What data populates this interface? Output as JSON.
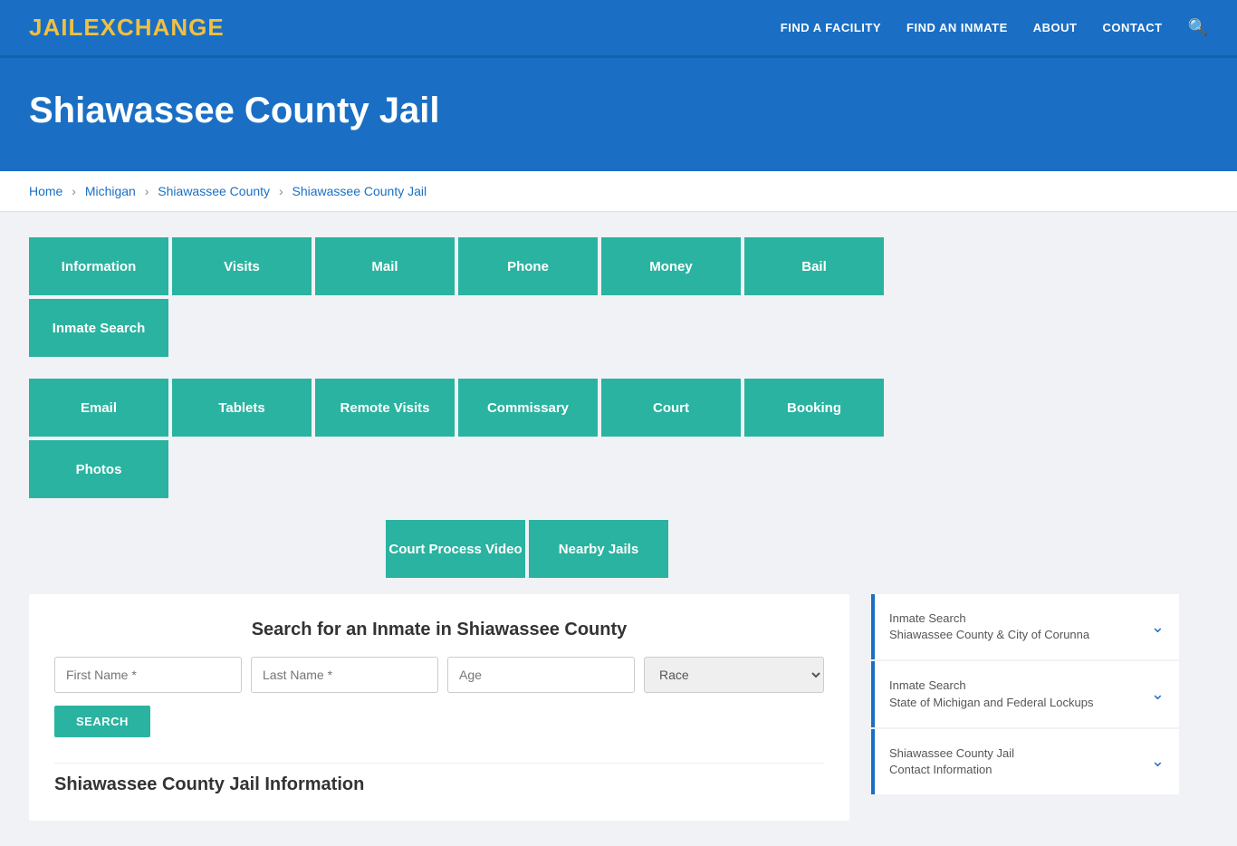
{
  "header": {
    "logo_jail": "JAIL",
    "logo_exchange": "EXCHANGE",
    "nav": [
      {
        "label": "FIND A FACILITY",
        "id": "find-facility"
      },
      {
        "label": "FIND AN INMATE",
        "id": "find-inmate"
      },
      {
        "label": "ABOUT",
        "id": "about"
      },
      {
        "label": "CONTACT",
        "id": "contact"
      }
    ]
  },
  "hero": {
    "title": "Shiawassee County Jail"
  },
  "breadcrumb": {
    "items": [
      "Home",
      "Michigan",
      "Shiawassee County",
      "Shiawassee County Jail"
    ]
  },
  "grid_row1": [
    "Information",
    "Visits",
    "Mail",
    "Phone",
    "Money",
    "Bail",
    "Inmate Search"
  ],
  "grid_row2": [
    "Email",
    "Tablets",
    "Remote Visits",
    "Commissary",
    "Court",
    "Booking",
    "Photos"
  ],
  "grid_row3": [
    "Court Process Video",
    "Nearby Jails"
  ],
  "search_form": {
    "title": "Search for an Inmate in Shiawassee County",
    "first_name_placeholder": "First Name *",
    "last_name_placeholder": "Last Name *",
    "age_placeholder": "Age",
    "race_placeholder": "Race",
    "search_button": "SEARCH"
  },
  "bottom_section": {
    "title": "Shiawassee County Jail Information"
  },
  "sidebar_cards": [
    {
      "title": "Inmate Search",
      "subtitle": "Shiawassee County & City of Corunna"
    },
    {
      "title": "Inmate Search",
      "subtitle": "State of Michigan and Federal Lockups"
    },
    {
      "title": "Shiawassee County Jail",
      "subtitle": "Contact Information"
    }
  ]
}
